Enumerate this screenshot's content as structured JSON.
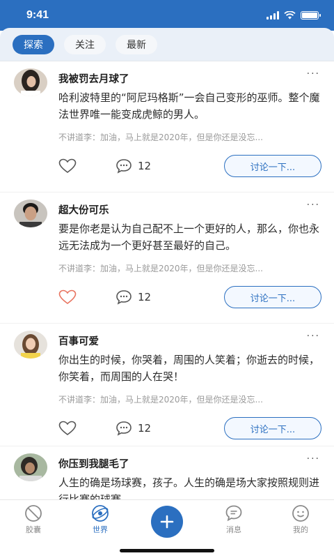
{
  "status": {
    "time": "9:41"
  },
  "tabs": [
    {
      "label": "探索",
      "active": true
    },
    {
      "label": "关注",
      "active": false
    },
    {
      "label": "最新",
      "active": false
    }
  ],
  "posts": [
    {
      "username": "我被罚去月球了",
      "text": "哈利波特里的“阿尼玛格斯”一会自己变形的巫师。整个魔法世界唯一能变成虎鲸的男人。",
      "comment": "不讲道李：加油，马上就是2020年，但是你还是没忘...",
      "comment_count": "12",
      "liked": false,
      "discuss_label": "讨论一下..."
    },
    {
      "username": "超大份可乐",
      "text": "要是你老是认为自己配不上一个更好的人，那么，你也永远无法成为一个更好甚至最好的自己。",
      "comment": "不讲道李：加油，马上就是2020年，但是你还是没忘...",
      "comment_count": "12",
      "liked": true,
      "discuss_label": "讨论一下..."
    },
    {
      "username": "百事可爱",
      "text": "你出生的时候，你哭着，周围的人笑着；你逝去的时候，你笑着，而周围的人在哭！",
      "comment": "不讲道李：加油，马上就是2020年，但是你还是没忘...",
      "comment_count": "12",
      "liked": false,
      "discuss_label": "讨论一下..."
    },
    {
      "username": "你压到我腿毛了",
      "text": "人生的确是场球赛，孩子。人生的确是场大家按照规则进行比赛的球赛。"
    }
  ],
  "nav": [
    {
      "label": "胶囊",
      "icon": "capsule-icon",
      "active": false
    },
    {
      "label": "世界",
      "icon": "world-icon",
      "active": true
    },
    {
      "label": "",
      "icon": "add-icon",
      "active": false
    },
    {
      "label": "消息",
      "icon": "message-icon",
      "active": false
    },
    {
      "label": "我的",
      "icon": "smile-icon",
      "active": false
    }
  ],
  "colors": {
    "primary": "#2b6fc0",
    "like_active": "#e8735f"
  }
}
